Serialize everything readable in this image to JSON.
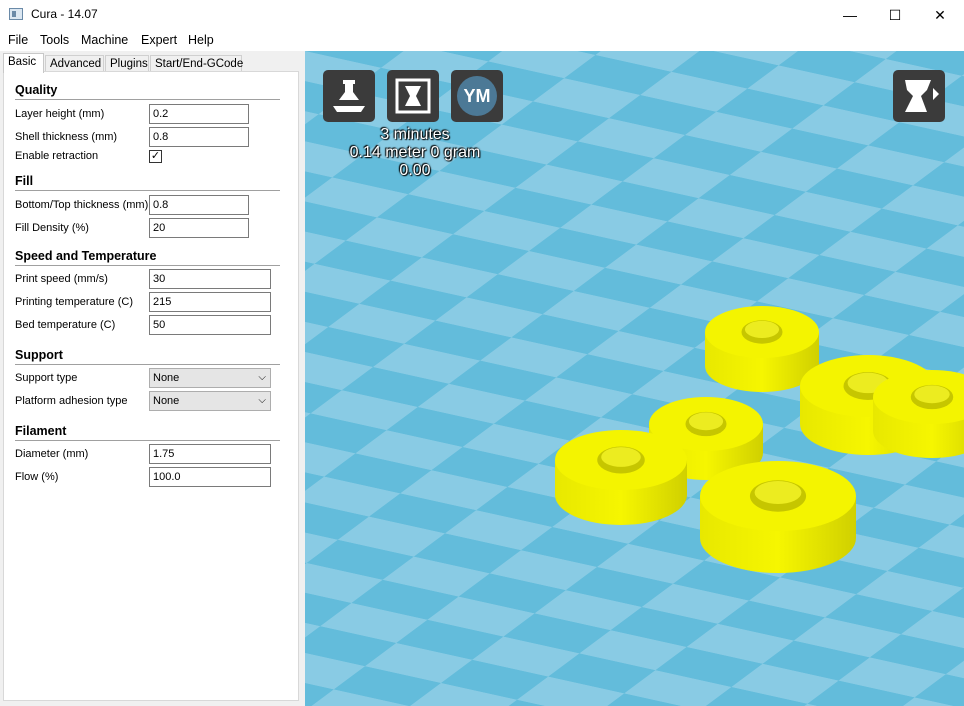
{
  "window": {
    "title": "Cura - 14.07",
    "minimize": "—",
    "maximize": "☐",
    "close": "✕"
  },
  "menu": [
    "File",
    "Tools",
    "Machine",
    "Expert",
    "Help"
  ],
  "tabs": [
    "Basic",
    "Advanced",
    "Plugins",
    "Start/End-GCode"
  ],
  "sections": {
    "quality": "Quality",
    "fill": "Fill",
    "speed": "Speed and Temperature",
    "support": "Support",
    "filament": "Filament"
  },
  "settings": {
    "layer_height": {
      "label": "Layer height (mm)",
      "value": "0.2"
    },
    "shell_thickness": {
      "label": "Shell thickness (mm)",
      "value": "0.8"
    },
    "enable_retraction": {
      "label": "Enable retraction",
      "checked": "✓"
    },
    "bottom_top": {
      "label": "Bottom/Top thickness (mm)",
      "value": "0.8"
    },
    "fill_density": {
      "label": "Fill Density (%)",
      "value": "20"
    },
    "print_speed": {
      "label": "Print speed (mm/s)",
      "value": "30"
    },
    "print_temp": {
      "label": "Printing temperature (C)",
      "value": "215"
    },
    "bed_temp": {
      "label": "Bed temperature (C)",
      "value": "50"
    },
    "support_type": {
      "label": "Support type",
      "value": "None"
    },
    "platform_adhesion": {
      "label": "Platform adhesion type",
      "value": "None"
    },
    "diameter": {
      "label": "Diameter (mm)",
      "value": "1.75"
    },
    "flow": {
      "label": "Flow (%)",
      "value": "100.0"
    }
  },
  "viewport": {
    "ym_label": "YM",
    "print_time": "3 minutes",
    "material": "0.14 meter 0 gram",
    "cost": "0.00",
    "colors": {
      "background": "#63bcdb",
      "tile": "#89cbe4",
      "model": "#f2f200"
    }
  }
}
